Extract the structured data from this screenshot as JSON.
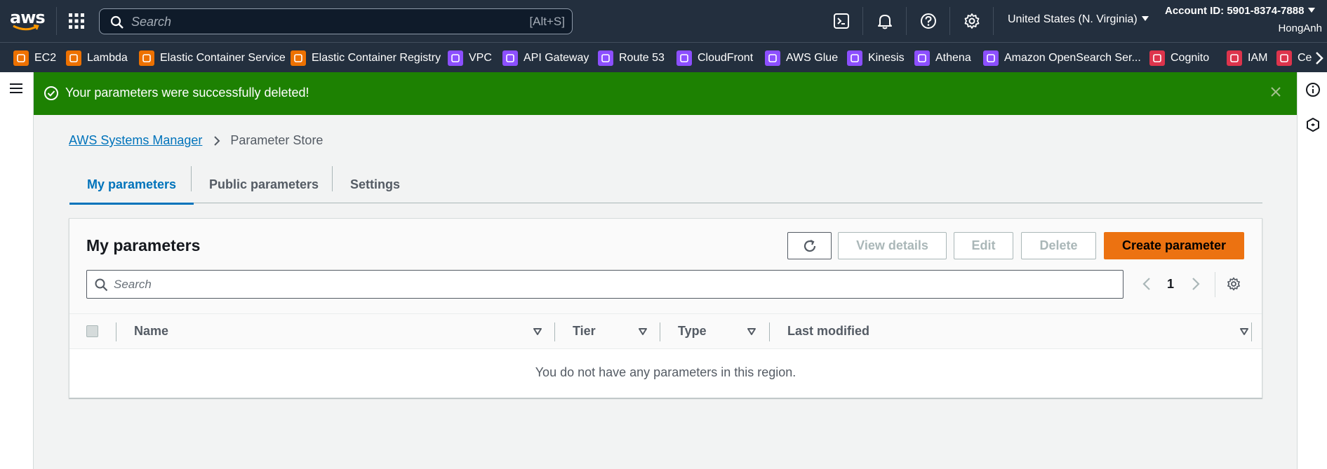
{
  "topnav": {
    "logo_text": "aws",
    "search_placeholder": "Search",
    "search_shortcut": "[Alt+S]",
    "region": "United States (N. Virginia)",
    "account": "Account ID: 5901-8374-7888",
    "username": "HongAnh",
    "icons": [
      "cloudshell-icon",
      "notifications-icon",
      "help-icon",
      "settings-icon"
    ]
  },
  "favorites": [
    {
      "label": "EC2",
      "color": "#ed7100"
    },
    {
      "label": "Lambda",
      "color": "#ed7100"
    },
    {
      "label": "Elastic Container Service",
      "color": "#ed7100"
    },
    {
      "label": "Elastic Container Registry",
      "color": "#ed7100"
    },
    {
      "label": "VPC",
      "color": "#8c4fff"
    },
    {
      "label": "API Gateway",
      "color": "#8c4fff"
    },
    {
      "label": "Route 53",
      "color": "#8c4fff"
    },
    {
      "label": "CloudFront",
      "color": "#8c4fff"
    },
    {
      "label": "AWS Glue",
      "color": "#8c4fff"
    },
    {
      "label": "Kinesis",
      "color": "#8c4fff"
    },
    {
      "label": "Athena",
      "color": "#8c4fff"
    },
    {
      "label": "Amazon OpenSearch Ser...",
      "color": "#8c4fff"
    },
    {
      "label": "Cognito",
      "color": "#dd344c"
    },
    {
      "label": "IAM",
      "color": "#dd344c"
    },
    {
      "label": "Ce",
      "color": "#dd344c"
    }
  ],
  "flash": {
    "message": "Your parameters were successfully deleted!",
    "color": "#1d8102"
  },
  "breadcrumb": {
    "parent": "AWS Systems Manager",
    "current": "Parameter Store"
  },
  "tabs": [
    {
      "label": "My parameters",
      "active": true
    },
    {
      "label": "Public parameters",
      "active": false
    },
    {
      "label": "Settings",
      "active": false
    }
  ],
  "panel": {
    "title": "My parameters",
    "buttons": {
      "view_details": "View details",
      "edit": "Edit",
      "delete": "Delete",
      "create": "Create parameter"
    },
    "search_placeholder": "Search",
    "page": "1",
    "columns": [
      "Name",
      "Tier",
      "Type",
      "Last modified"
    ],
    "empty_message": "You do not have any parameters in this region."
  },
  "colors": {
    "nav_bg": "#232f3e",
    "link": "#0073bb",
    "primary": "#ec7211"
  }
}
